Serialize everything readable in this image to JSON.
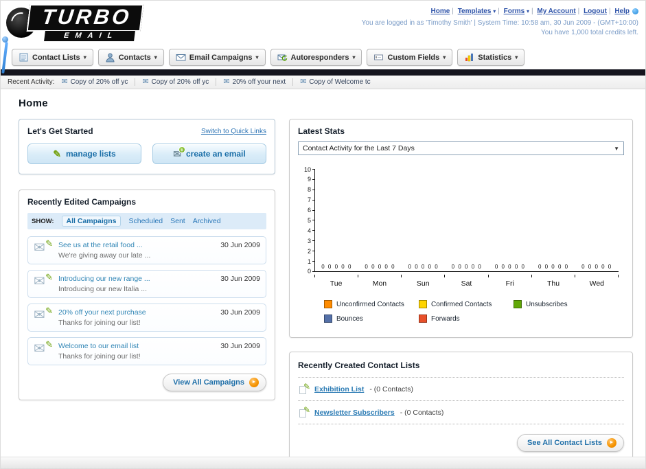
{
  "colors": {
    "accent_blue": "#2a7fae",
    "dark_bar": "#15151e",
    "unconfirmed_orange": "#ff8c00",
    "confirmed_yellow": "#ffd400",
    "unsubscribes_green": "#61a807",
    "bounces_blue": "#5470a8",
    "forwards_red": "#e8502a"
  },
  "icons": {
    "caret": "▾",
    "envelope": "✉",
    "pencil": "✎",
    "arrow": "►",
    "plus": "+",
    "select_arrow": "▼"
  },
  "header": {
    "logo_line1": "TURBO",
    "logo_line2": "EMAIL",
    "links": [
      "Home",
      "Templates",
      "Forms",
      "My Account",
      "Logout",
      "Help"
    ],
    "login_info": "You are logged in as 'Timothy Smith' | System Time: 10:58 am, 30 Jun 2009 - (GMT+10:00)",
    "credits": "You have 1,000 total credits left."
  },
  "nav": {
    "tabs": [
      {
        "label": "Contact Lists"
      },
      {
        "label": "Contacts"
      },
      {
        "label": "Email Campaigns"
      },
      {
        "label": "Autoresponders"
      },
      {
        "label": "Custom Fields"
      },
      {
        "label": "Statistics"
      }
    ]
  },
  "activity": {
    "label": "Recent Activity:",
    "items": [
      {
        "text": "Copy of 20% off yc"
      },
      {
        "text": "Copy of 20% off yc"
      },
      {
        "text": "20% off your next"
      },
      {
        "text": "Copy of Welcome tc"
      }
    ]
  },
  "page_title": "Home",
  "get_started": {
    "title": "Let's Get Started",
    "switch_link": "Switch to Quick Links",
    "manage_label": "manage lists",
    "create_label": "create an email"
  },
  "campaigns": {
    "title": "Recently Edited Campaigns",
    "show_label": "SHOW:",
    "tabs": [
      "All Campaigns",
      "Scheduled",
      "Sent",
      "Archived"
    ],
    "items": [
      {
        "title": "See us at the retail food ...",
        "subtitle": "We're giving away our late ...",
        "date": "30 Jun 2009"
      },
      {
        "title": "Introducing our new range ...",
        "subtitle": "Introducing our new Italia ...",
        "date": "30 Jun 2009"
      },
      {
        "title": "20% off your next purchase",
        "subtitle": "Thanks for joining our list!",
        "date": "30 Jun 2009"
      },
      {
        "title": "Welcome to our email list",
        "subtitle": "Thanks for joining our list!",
        "date": "30 Jun 2009"
      }
    ],
    "view_all": "View All Campaigns"
  },
  "stats": {
    "title": "Latest Stats",
    "selector_value": "Contact Activity for the Last 7 Days",
    "chart_data": {
      "type": "bar",
      "title": "Contact Activity for the Last 7 Days",
      "categories": [
        "Tue",
        "Mon",
        "Sun",
        "Sat",
        "Fri",
        "Thu",
        "Wed"
      ],
      "series": [
        {
          "name": "Unconfirmed Contacts",
          "color": "#ff8c00",
          "values": [
            0,
            0,
            0,
            0,
            0,
            0,
            0
          ]
        },
        {
          "name": "Confirmed Contacts",
          "color": "#ffd400",
          "values": [
            0,
            0,
            0,
            0,
            0,
            0,
            0
          ]
        },
        {
          "name": "Unsubscribes",
          "color": "#61a807",
          "values": [
            0,
            0,
            0,
            0,
            0,
            0,
            0
          ]
        },
        {
          "name": "Bounces",
          "color": "#5470a8",
          "values": [
            0,
            0,
            0,
            0,
            0,
            0,
            0
          ]
        },
        {
          "name": "Forwards",
          "color": "#e8502a",
          "values": [
            0,
            0,
            0,
            0,
            0,
            0,
            0
          ]
        }
      ],
      "ylim": [
        0,
        10
      ],
      "yticks": [
        10,
        9,
        8,
        7,
        6,
        5,
        4,
        3,
        2,
        1,
        0
      ],
      "value_label_group": "0 0 0 0 0",
      "grid": false,
      "legend_position": "bottom",
      "xlabel": "",
      "ylabel": ""
    }
  },
  "lists": {
    "title": "Recently Created Contact Lists",
    "items": [
      {
        "name": "Exhibition List",
        "meta": "- (0 Contacts)"
      },
      {
        "name": "Newsletter Subscribers",
        "meta": "- (0 Contacts)"
      }
    ],
    "see_all": "See All Contact Lists"
  }
}
